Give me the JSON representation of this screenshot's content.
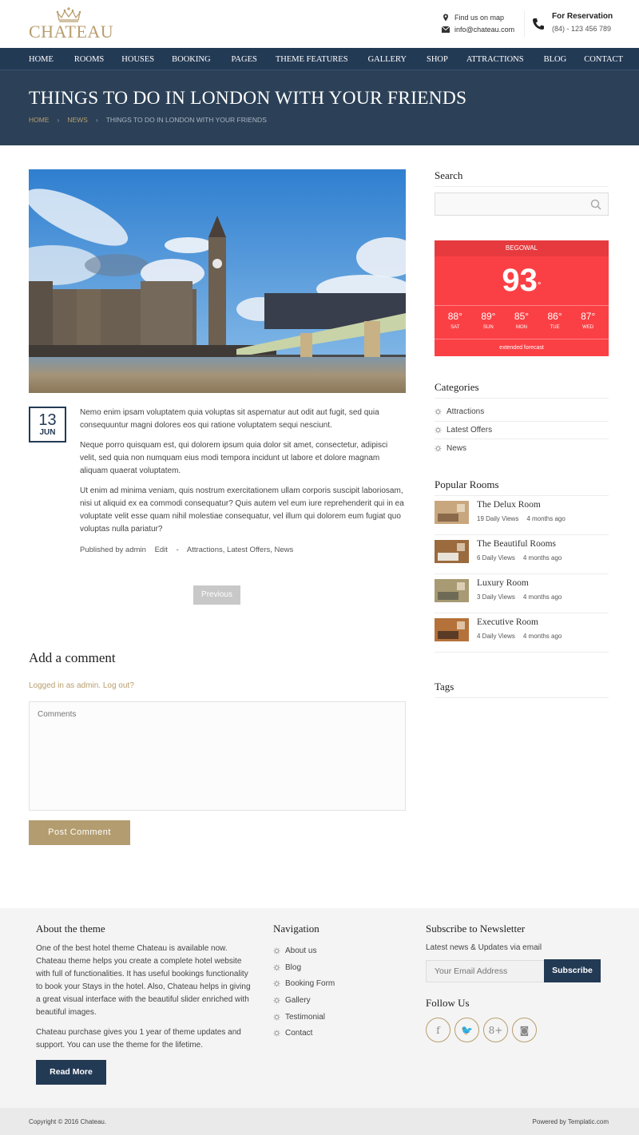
{
  "brand": {
    "name": "CHATEAU",
    "logo_icon": "crown-icon",
    "accent": "#b89e6e",
    "navy": "#233a55"
  },
  "header": {
    "map_label": "Find us on map",
    "email": "info@chateau.com",
    "reservation_label": "For Reservation",
    "phone": "(84) - 123 456 789"
  },
  "nav": [
    "HOME",
    "ROOMS",
    "HOUSES",
    "BOOKING",
    "PAGES",
    "THEME FEATURES",
    "GALLERY",
    "SHOP",
    "ATTRACTIONS",
    "BLOG",
    "CONTACT"
  ],
  "page": {
    "title": "THINGS TO DO IN LONDON WITH YOUR FRIENDS",
    "breadcrumb": [
      "HOME",
      "NEWS",
      "THINGS TO DO IN LONDON WITH YOUR FRIENDS"
    ]
  },
  "post": {
    "image_alt": "Big Ben and Westminster Bridge, London",
    "day": "13",
    "month": "JUN",
    "paragraphs": [
      "Nemo enim ipsam voluptatem quia voluptas sit aspernatur aut odit aut fugit, sed quia consequuntur magni dolores eos qui ratione voluptatem sequi nesciunt.",
      "Neque porro quisquam est, qui dolorem ipsum quia dolor sit amet, consectetur, adipisci velit, sed quia non numquam eius modi tempora incidunt ut labore et dolore magnam aliquam quaerat voluptatem.",
      "Ut enim ad minima veniam, quis nostrum exercitationem ullam corporis suscipit laboriosam, nisi ut aliquid ex ea commodi consequatur? Quis autem vel eum iure reprehenderit qui in ea voluptate velit esse quam nihil molestiae consequatur, vel illum qui dolorem eum fugiat quo voluptas nulla pariatur?"
    ],
    "published_by": "Published by admin",
    "edit": "Edit",
    "dash": "-",
    "categories": "Attractions, Latest Offers, News",
    "previous": "Previous"
  },
  "comment": {
    "title": "Add a comment",
    "logged_in": "Logged in as admin. Log out?",
    "placeholder": "Comments",
    "submit": "Post Comment"
  },
  "sidebar": {
    "search_title": "Search",
    "search_placeholder": "",
    "weather": {
      "city": "BEGOWAL",
      "temp": "93",
      "deg": "°",
      "forecast": [
        {
          "temp": "88°",
          "day": "SAT"
        },
        {
          "temp": "89°",
          "day": "SUN"
        },
        {
          "temp": "85°",
          "day": "MON"
        },
        {
          "temp": "86°",
          "day": "TUE"
        },
        {
          "temp": "87°",
          "day": "WED"
        }
      ],
      "extended": "extended forecast",
      "color": "#fb4045"
    },
    "categories_title": "Categories",
    "categories": [
      "Attractions",
      "Latest Offers",
      "News"
    ],
    "popular_title": "Popular Rooms",
    "rooms": [
      {
        "name": "The Delux Room",
        "views": "19 Daily Views",
        "ago": "4 months ago"
      },
      {
        "name": "The Beautiful Rooms",
        "views": "6 Daily Views",
        "ago": "4 months ago"
      },
      {
        "name": "Luxury Room",
        "views": "3 Daily Views",
        "ago": "4 months ago"
      },
      {
        "name": "Executive Room",
        "views": "4 Daily Views",
        "ago": "4 months ago"
      }
    ],
    "tags_title": "Tags"
  },
  "footer": {
    "about_title": "About the theme",
    "about_paragraphs": [
      "One of the best hotel theme Chateau is available now. Chateau theme helps you create a complete hotel website with full of functionalities. It has useful bookings functionality to book your Stays in the hotel. Also, Chateau helps in giving a great visual interface with the beautiful slider enriched with beautiful images.",
      "Chateau purchase gives you 1 year of theme updates and support. You can use the theme for the lifetime."
    ],
    "read_more": "Read More",
    "nav_title": "Navigation",
    "nav_items": [
      "About us",
      "Blog",
      "Booking Form",
      "Gallery",
      "Testimonial",
      "Contact"
    ],
    "newsletter_title": "Subscribe to Newsletter",
    "newsletter_sub": "Latest news & Updates via email",
    "email_placeholder": "Your Email Address",
    "subscribe": "Subscribe",
    "follow_title": "Follow Us",
    "social": [
      {
        "name": "facebook-icon",
        "glyph": "f"
      },
      {
        "name": "twitter-icon",
        "glyph": "🐦"
      },
      {
        "name": "google-plus-icon",
        "glyph": "8+"
      },
      {
        "name": "instagram-icon",
        "glyph": "◙"
      }
    ],
    "copyright": "Copyright © 2016 Chateau.",
    "powered": "Powered by Templatic.com"
  }
}
